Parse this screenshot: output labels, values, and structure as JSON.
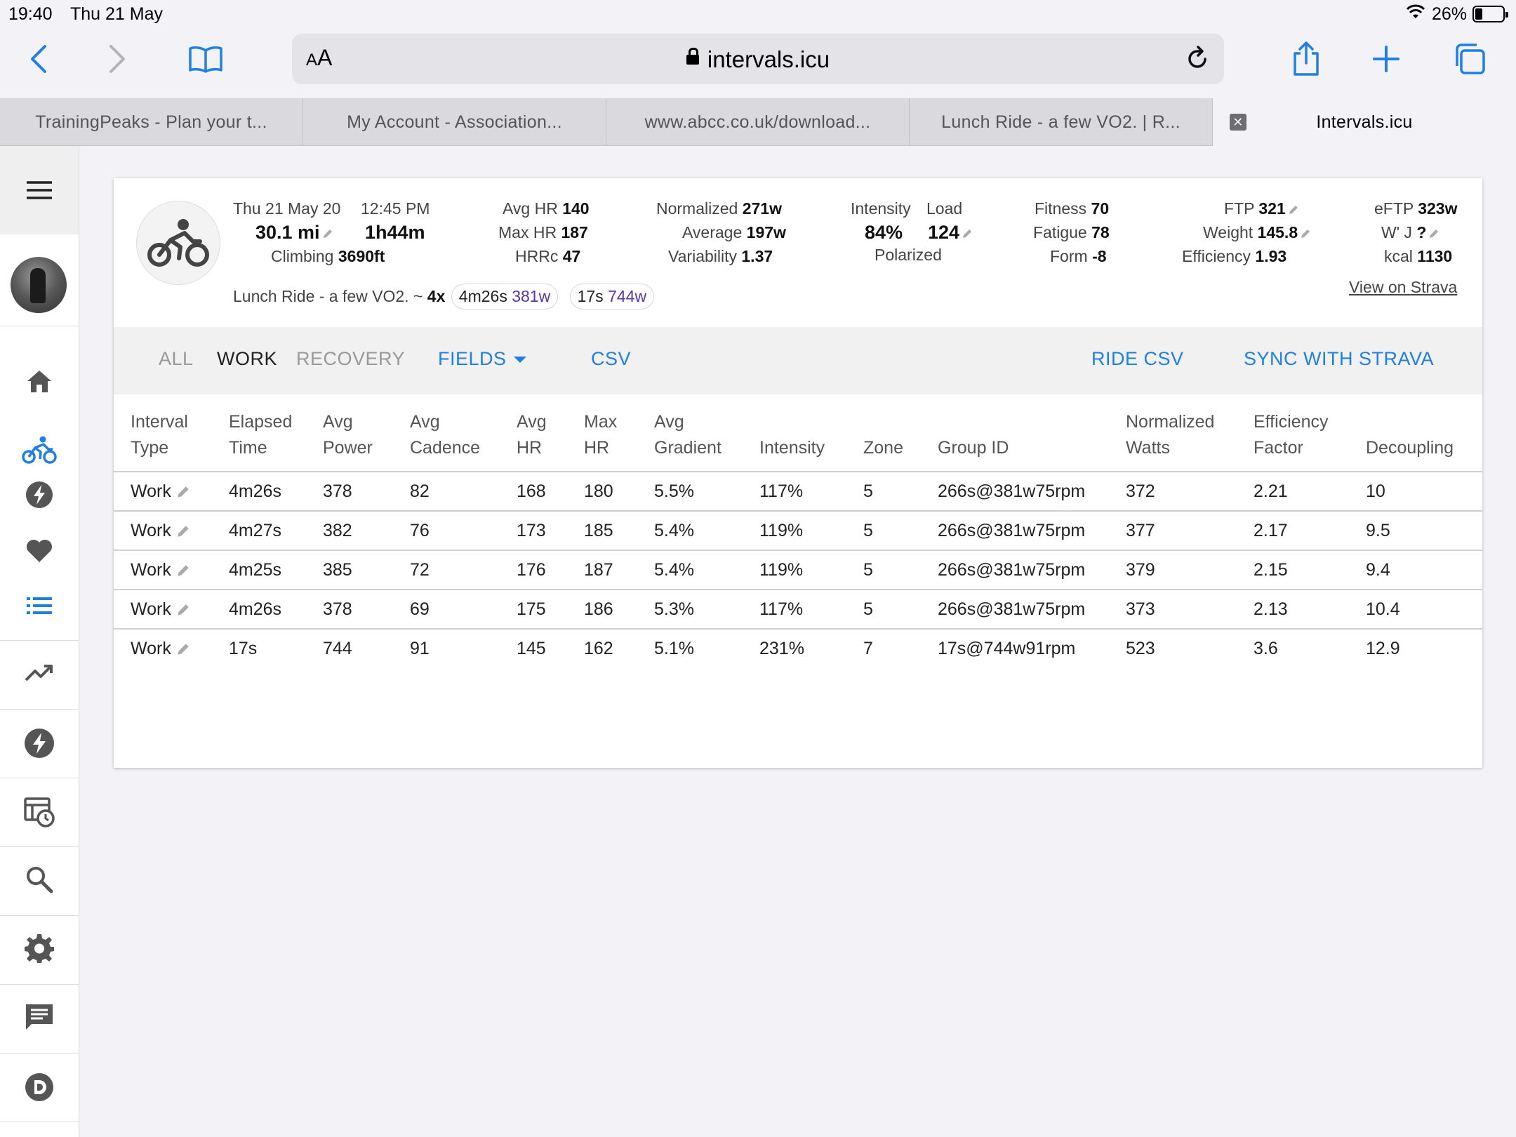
{
  "status": {
    "time": "19:40",
    "date": "Thu 21 May",
    "battery": "26%",
    "battery_level": 0.26
  },
  "browser": {
    "text_size": "AA",
    "url": "intervals.icu",
    "tabs": [
      {
        "label": "TrainingPeaks - Plan your t..."
      },
      {
        "label": "My Account - Association..."
      },
      {
        "label": "www.abcc.co.uk/download..."
      },
      {
        "label": "Lunch Ride - a few VO2. | R..."
      },
      {
        "label": "Intervals.icu",
        "active": true
      }
    ]
  },
  "sidebar": {
    "items": [
      {
        "icon": "home-icon"
      },
      {
        "icon": "bike-icon",
        "active": true
      },
      {
        "icon": "bolt-icon"
      },
      {
        "icon": "heart-icon"
      },
      {
        "icon": "list-icon",
        "active": true
      },
      {
        "icon": "trending-icon"
      },
      {
        "icon": "power-icon"
      },
      {
        "icon": "calendar-clock-icon"
      },
      {
        "icon": "search-icon"
      },
      {
        "icon": "gear-icon"
      },
      {
        "icon": "chat-icon"
      },
      {
        "icon": "discord-icon"
      }
    ]
  },
  "activity": {
    "date": "Thu 21 May 20",
    "time": "12:45 PM",
    "distance": "30.1 mi",
    "duration": "1h44m",
    "climbing_label": "Climbing",
    "climbing": "3690ft",
    "avg_hr_label": "Avg HR",
    "avg_hr": "140",
    "max_hr_label": "Max HR",
    "max_hr": "187",
    "hrrc_label": "HRRc",
    "hrrc": "47",
    "normalized_label": "Normalized",
    "normalized": "271w",
    "average_label": "Average",
    "average": "197w",
    "variability_label": "Variability",
    "variability": "1.37",
    "intensity_label": "Intensity",
    "intensity": "84%",
    "load_label": "Load",
    "load": "124",
    "polarized": "Polarized",
    "fitness_label": "Fitness",
    "fitness": "70",
    "fatigue_label": "Fatigue",
    "fatigue": "78",
    "form_label": "Form",
    "form": "-8",
    "ftp_label": "FTP",
    "ftp": "321",
    "weight_label": "Weight",
    "weight": "145.8",
    "efficiency_label": "Efficiency",
    "efficiency": "1.93",
    "eftp_label": "eFTP",
    "eftp": "323w",
    "wj_label": "W' J",
    "wj": "?",
    "kcal_label": "kcal",
    "kcal": "1130",
    "view_strava": "View on Strava",
    "name": "Lunch Ride - a few VO2. ~",
    "reps": "4x",
    "chip1_time": "4m26s",
    "chip1_watts": "381w",
    "chip2_time": "17s",
    "chip2_watts": "744w"
  },
  "actions": {
    "all": "ALL",
    "work": "WORK",
    "recovery": "RECOVERY",
    "fields": "FIELDS",
    "csv": "CSV",
    "ride_csv": "RIDE CSV",
    "sync": "SYNC WITH STRAVA"
  },
  "table": {
    "headers": [
      [
        "Interval",
        "Type"
      ],
      [
        "Elapsed",
        "Time"
      ],
      [
        "Avg",
        "Power"
      ],
      [
        "Avg",
        "Cadence"
      ],
      [
        "Avg",
        "HR"
      ],
      [
        "Max",
        "HR"
      ],
      [
        "Avg",
        "Gradient"
      ],
      [
        "",
        "Intensity"
      ],
      [
        "",
        "Zone"
      ],
      [
        "",
        "Group ID"
      ],
      [
        "Normalized",
        "Watts"
      ],
      [
        "Efficiency",
        "Factor"
      ],
      [
        "",
        "Decoupling"
      ]
    ],
    "rows": [
      [
        "Work",
        "4m26s",
        "378",
        "82",
        "168",
        "180",
        "5.5%",
        "117%",
        "5",
        "266s@381w75rpm",
        "372",
        "2.21",
        "10"
      ],
      [
        "Work",
        "4m27s",
        "382",
        "76",
        "173",
        "185",
        "5.4%",
        "119%",
        "5",
        "266s@381w75rpm",
        "377",
        "2.17",
        "9.5"
      ],
      [
        "Work",
        "4m25s",
        "385",
        "72",
        "176",
        "187",
        "5.4%",
        "119%",
        "5",
        "266s@381w75rpm",
        "379",
        "2.15",
        "9.4"
      ],
      [
        "Work",
        "4m26s",
        "378",
        "69",
        "175",
        "186",
        "5.3%",
        "117%",
        "5",
        "266s@381w75rpm",
        "373",
        "2.13",
        "10.4"
      ],
      [
        "Work",
        "17s",
        "744",
        "91",
        "145",
        "162",
        "5.1%",
        "231%",
        "7",
        "17s@744w91rpm",
        "523",
        "3.6",
        "12.9"
      ]
    ]
  }
}
